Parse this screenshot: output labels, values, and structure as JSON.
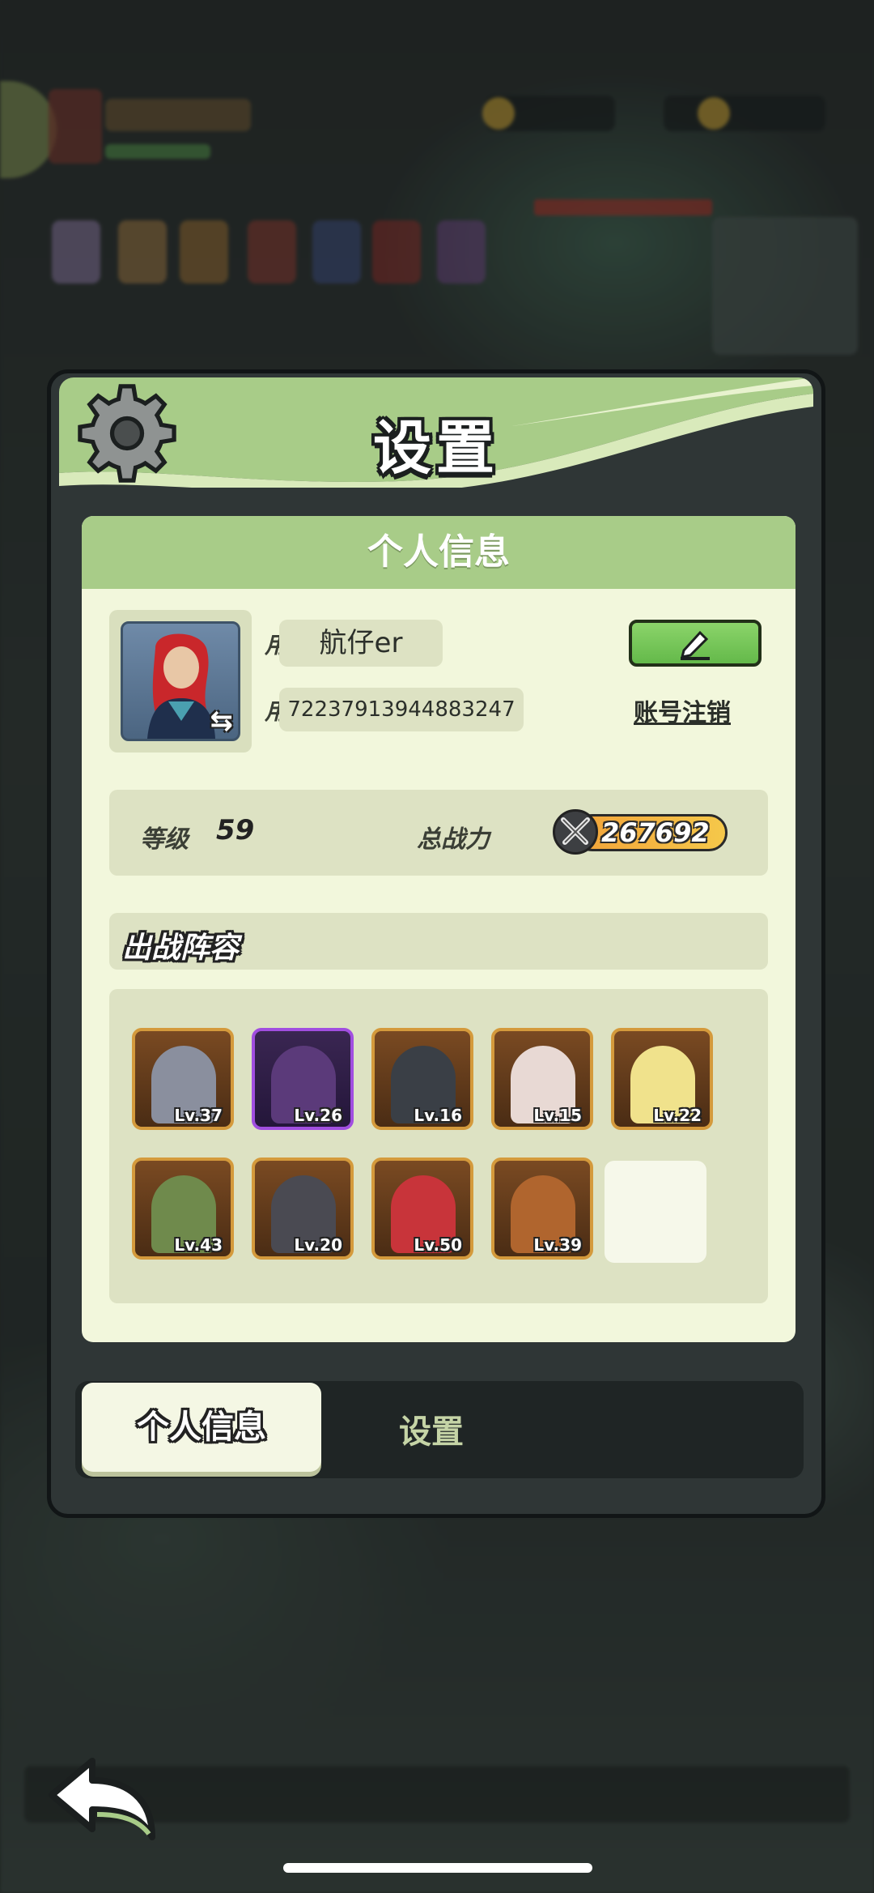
{
  "window": {
    "title": "设置"
  },
  "profile_card": {
    "header": "个人信息",
    "nickname_label": "用户昵称",
    "nickname_value": "航仔er",
    "uid_label": "用户  ID",
    "uid_value": "7223791394488324 7",
    "logout_label": "账号注销"
  },
  "stats": {
    "level_label": "等级",
    "level_value": "59",
    "power_label": "总战力",
    "power_value": "267692"
  },
  "lineup": {
    "title": "出战阵容",
    "heroes": [
      {
        "level": "Lv.37",
        "color": "#8a8f9e",
        "frame": "gold"
      },
      {
        "level": "Lv.26",
        "color": "#5b3a7a",
        "frame": "purple"
      },
      {
        "level": "Lv.16",
        "color": "#3a3f46",
        "frame": "gold"
      },
      {
        "level": "Lv.15",
        "color": "#e8d9d4",
        "frame": "gold"
      },
      {
        "level": "Lv.22",
        "color": "#f0e28c",
        "frame": "gold"
      },
      {
        "level": "Lv.43",
        "color": "#6f8a4c",
        "frame": "gold"
      },
      {
        "level": "Lv.20",
        "color": "#4a4a52",
        "frame": "gold"
      },
      {
        "level": "Lv.50",
        "color": "#c8343a",
        "frame": "gold"
      },
      {
        "level": "Lv.39",
        "color": "#b0652e",
        "frame": "gold"
      }
    ]
  },
  "tabs": [
    {
      "label": "个人信息",
      "active": true
    },
    {
      "label": "设置",
      "active": false
    }
  ],
  "colors": {
    "header_green": "#a8cc88",
    "card_bg": "#f2f7dc",
    "field_bg": "#dde2c3",
    "edit_button": "#64b94a",
    "panel_frame": "#111516"
  },
  "icons": [
    "gear-icon",
    "swap-icon",
    "edit-pencil-icon",
    "sword-power-icon",
    "back-arrow-icon"
  ]
}
